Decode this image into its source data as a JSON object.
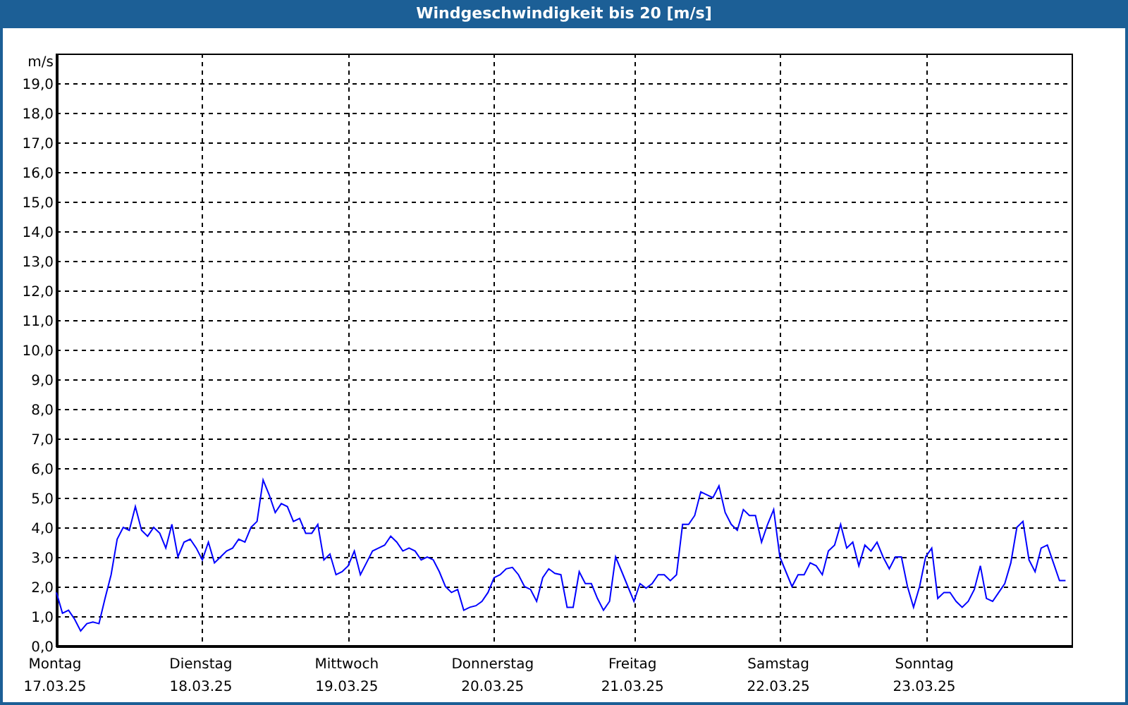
{
  "window": {
    "title": "Windgeschwindigkeit bis 20 [m/s]"
  },
  "chart": {
    "chart_data": {
      "type": "line",
      "grid": true,
      "ylabel": "m/s",
      "ylim": [
        0,
        20
      ],
      "yticks": [
        {
          "value": 0,
          "label": "0,0"
        },
        {
          "value": 1,
          "label": "1,0"
        },
        {
          "value": 2,
          "label": "2,0"
        },
        {
          "value": 3,
          "label": "3,0"
        },
        {
          "value": 4,
          "label": "4,0"
        },
        {
          "value": 5,
          "label": "5,0"
        },
        {
          "value": 6,
          "label": "6,0"
        },
        {
          "value": 7,
          "label": "7,0"
        },
        {
          "value": 8,
          "label": "8,0"
        },
        {
          "value": 9,
          "label": "9,0"
        },
        {
          "value": 10,
          "label": "10,0"
        },
        {
          "value": 11,
          "label": "11,0"
        },
        {
          "value": 12,
          "label": "12,0"
        },
        {
          "value": 13,
          "label": "13,0"
        },
        {
          "value": 14,
          "label": "14,0"
        },
        {
          "value": 15,
          "label": "15,0"
        },
        {
          "value": 16,
          "label": "16,0"
        },
        {
          "value": 17,
          "label": "17,0"
        },
        {
          "value": 18,
          "label": "18,0"
        },
        {
          "value": 19,
          "label": "19,0"
        }
      ],
      "categories": [
        "Montag 17.03.25",
        null,
        null,
        null,
        null,
        null,
        null,
        null,
        null,
        null,
        null,
        null,
        null,
        null,
        null,
        null,
        null,
        null,
        null,
        null,
        null,
        null,
        null,
        null,
        "Dienstag 18.03.25",
        null,
        null,
        null,
        null,
        null,
        null,
        null,
        null,
        null,
        null,
        null,
        null,
        null,
        null,
        null,
        null,
        null,
        null,
        null,
        null,
        null,
        null,
        null,
        "Mittwoch 19.03.25",
        null,
        null,
        null,
        null,
        null,
        null,
        null,
        null,
        null,
        null,
        null,
        null,
        null,
        null,
        null,
        null,
        null,
        null,
        null,
        null,
        null,
        null,
        null,
        "Donnerstag 20.03.25",
        null,
        null,
        null,
        null,
        null,
        null,
        null,
        null,
        null,
        null,
        null,
        null,
        null,
        null,
        null,
        null,
        null,
        null,
        null,
        null,
        null,
        null,
        "Freitag 21.03.25",
        null,
        null,
        null,
        null,
        null,
        null,
        null,
        null,
        null,
        null,
        null,
        null,
        null,
        null,
        null,
        null,
        null,
        null,
        null,
        null,
        null,
        null,
        null,
        "Samstag 22.03.25",
        null,
        null,
        null,
        null,
        null,
        null,
        null,
        null,
        null,
        null,
        null,
        null,
        null,
        null,
        null,
        null,
        null,
        null,
        null,
        null,
        null,
        null,
        null,
        "Sonntag 23.03.25",
        null,
        null,
        null,
        null,
        null,
        null,
        null,
        null,
        null,
        null,
        null,
        null,
        null,
        null,
        null,
        null,
        null,
        null,
        null,
        null,
        null,
        null,
        null
      ],
      "series": [
        {
          "color": "#0000ff",
          "values": [
            1.8,
            1.1,
            1.2,
            0.9,
            0.5,
            0.75,
            0.8,
            0.75,
            1.6,
            2.4,
            3.6,
            4.0,
            3.9,
            4.7,
            3.9,
            3.7,
            4.0,
            3.8,
            3.3,
            4.1,
            3.0,
            3.5,
            3.6,
            3.3,
            2.9,
            3.5,
            2.8,
            3.0,
            3.2,
            3.3,
            3.6,
            3.5,
            4.0,
            4.2,
            5.6,
            5.1,
            4.5,
            4.8,
            4.7,
            4.2,
            4.3,
            3.8,
            3.8,
            4.1,
            2.9,
            3.1,
            2.4,
            2.5,
            2.7,
            3.2,
            2.4,
            2.8,
            3.2,
            3.3,
            3.4,
            3.7,
            3.5,
            3.2,
            3.3,
            3.2,
            2.9,
            3.0,
            2.9,
            2.5,
            2.0,
            1.8,
            1.9,
            1.2,
            1.3,
            1.35,
            1.5,
            1.8,
            2.3,
            2.4,
            2.6,
            2.65,
            2.4,
            2.0,
            1.9,
            1.5,
            2.3,
            2.6,
            2.45,
            2.4,
            1.3,
            1.3,
            2.5,
            2.1,
            2.1,
            1.6,
            1.2,
            1.5,
            3.0,
            2.5,
            2.0,
            1.5,
            2.1,
            1.95,
            2.1,
            2.4,
            2.4,
            2.2,
            2.4,
            4.1,
            4.1,
            4.4,
            5.2,
            5.1,
            5.0,
            5.4,
            4.5,
            4.1,
            3.9,
            4.6,
            4.4,
            4.4,
            3.5,
            4.1,
            4.6,
            3.0,
            2.5,
            2.0,
            2.4,
            2.4,
            2.8,
            2.7,
            2.4,
            3.2,
            3.4,
            4.1,
            3.3,
            3.5,
            2.7,
            3.4,
            3.2,
            3.5,
            3.0,
            2.6,
            3.0,
            3.0,
            2.0,
            1.3,
            2.0,
            3.0,
            3.3,
            1.6,
            1.8,
            1.8,
            1.5,
            1.3,
            1.5,
            1.9,
            2.7,
            1.6,
            1.5,
            1.8,
            2.1,
            2.8,
            4.0,
            4.2,
            2.9,
            2.5,
            3.3,
            3.4,
            2.8,
            2.2,
            2.2
          ]
        }
      ]
    }
  }
}
